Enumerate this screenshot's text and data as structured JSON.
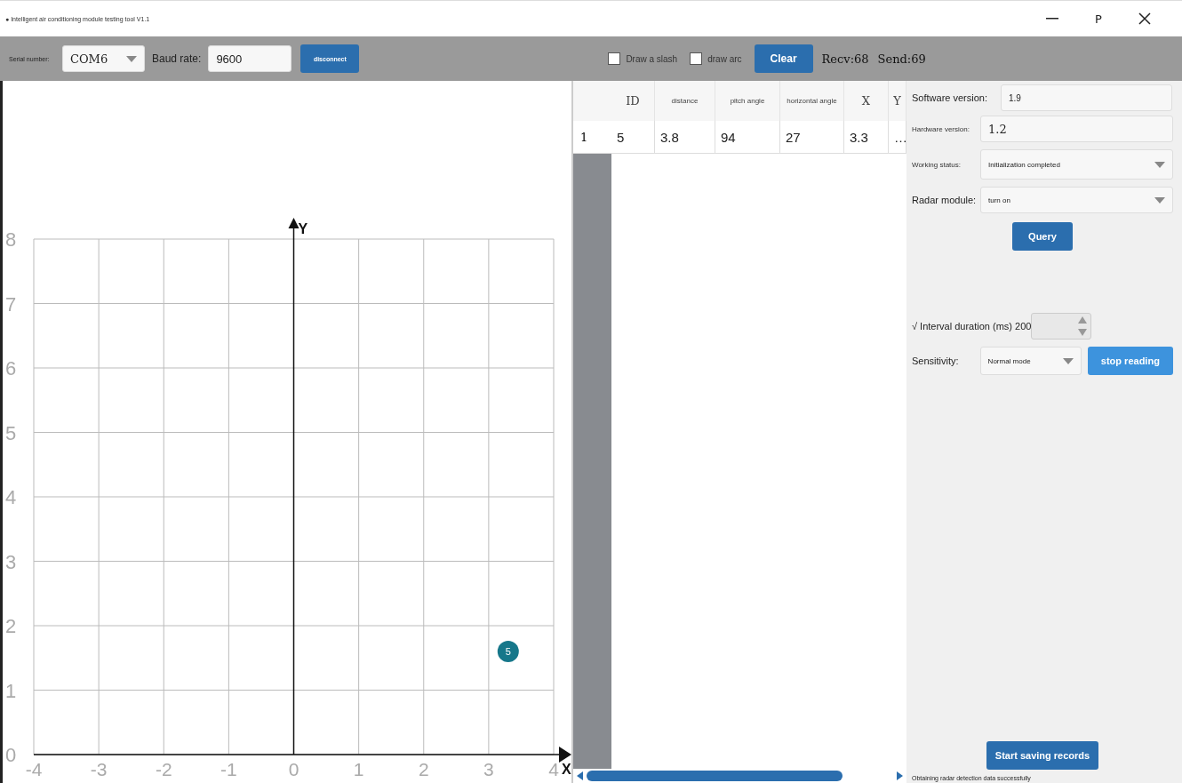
{
  "window": {
    "title": "● Intelligent air conditioning module testing tool V1.1",
    "controls": [
      "P"
    ]
  },
  "toolbar": {
    "serial_label": "Serial number:",
    "serial_port": "COM6",
    "baud_label": "Baud rate:",
    "baud_rate": "9600",
    "connect_button": "disconnect",
    "checkboxes": [
      {
        "label": "Draw a slash",
        "checked": false
      },
      {
        "label": "draw arc",
        "checked": false
      }
    ],
    "clear_button": "Clear",
    "recv": "Recv:68",
    "send": "Send:69"
  },
  "plot": {
    "chart_data": {
      "type": "scatter",
      "xlabel": "X",
      "ylabel": "Y",
      "x": [
        3.3
      ],
      "grid": true,
      "series": [
        {
          "color": "#16778a",
          "values": [
            1.6
          ]
        }
      ],
      "value_labels": [
        "5"
      ],
      "xlim": [
        -4,
        4
      ],
      "ylim": [
        0,
        8
      ],
      "xticks": [
        -4,
        -3,
        -2,
        -1,
        0,
        1,
        2,
        3,
        4
      ],
      "yticks": [
        0,
        1,
        2,
        3,
        4,
        5,
        6,
        7,
        8
      ]
    }
  },
  "table": {
    "columns": [
      "ID",
      "distance",
      "pitch angle",
      "horizontal angle",
      "X",
      "Y"
    ],
    "rows": [
      {
        "number": "1",
        "cells": [
          "5",
          "3.8",
          "94",
          "27",
          "3.3",
          "…"
        ]
      }
    ]
  },
  "settings": {
    "software_label": "Software version:",
    "software_value": "1.9",
    "hardware_label": "Hardware version:",
    "hardware_value": "1.2",
    "working_label": "Working status:",
    "working_value": "Initialization completed",
    "radar_label": "Radar module:",
    "radar_value": "turn on",
    "query_button": "Query",
    "interval_label": "√ Interval duration (ms) 200",
    "sensitivity_label": "Sensitivity:",
    "sensitivity_value": "Normal mode",
    "stop_button": "stop reading",
    "save_button": "Start saving records",
    "status": "Obtaining radar detection data successfully"
  }
}
